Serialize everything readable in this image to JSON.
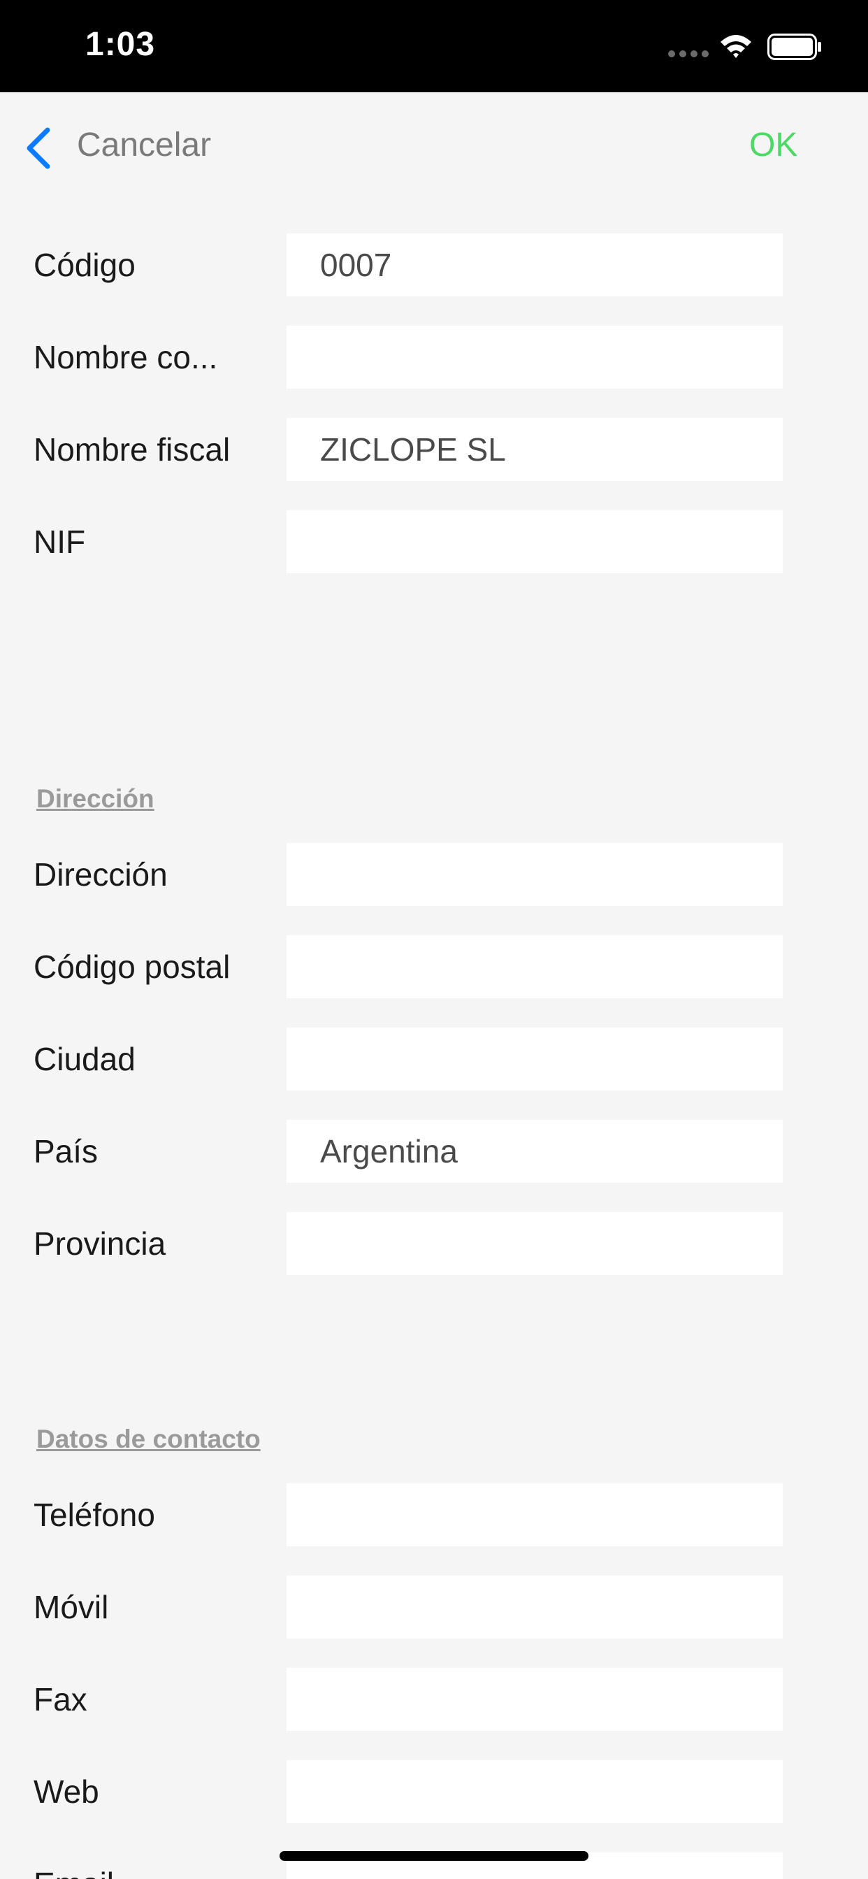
{
  "status_bar": {
    "time": "1:03",
    "icons": [
      "signal-dots-icon",
      "wifi-icon",
      "battery-icon"
    ]
  },
  "nav": {
    "back_icon": "chevron-left-icon",
    "cancel_label": "Cancelar",
    "ok_label": "OK"
  },
  "colors": {
    "accent_blue": "#0a7aff",
    "ok_green": "#4cd964",
    "background": "#f5f5f5",
    "field_background": "#ffffff"
  },
  "general": {
    "codigo": {
      "label": "Código",
      "value": "0007"
    },
    "nombre_comercial": {
      "label": "Nombre co...",
      "value": ""
    },
    "nombre_fiscal": {
      "label": "Nombre fiscal",
      "value": "ZICLOPE SL"
    },
    "nif": {
      "label": "NIF",
      "value": ""
    }
  },
  "direccion_section": {
    "title": "Dirección",
    "direccion": {
      "label": "Dirección",
      "value": ""
    },
    "codigo_postal": {
      "label": "Código postal",
      "value": ""
    },
    "ciudad": {
      "label": "Ciudad",
      "value": ""
    },
    "pais": {
      "label": "País",
      "value": "Argentina"
    },
    "provincia": {
      "label": "Provincia",
      "value": ""
    }
  },
  "contacto_section": {
    "title": "Datos de contacto",
    "telefono": {
      "label": "Teléfono",
      "value": ""
    },
    "movil": {
      "label": "Móvil",
      "value": ""
    },
    "fax": {
      "label": "Fax",
      "value": ""
    },
    "web": {
      "label": "Web",
      "value": ""
    },
    "email": {
      "label": "Email",
      "value": ""
    }
  }
}
